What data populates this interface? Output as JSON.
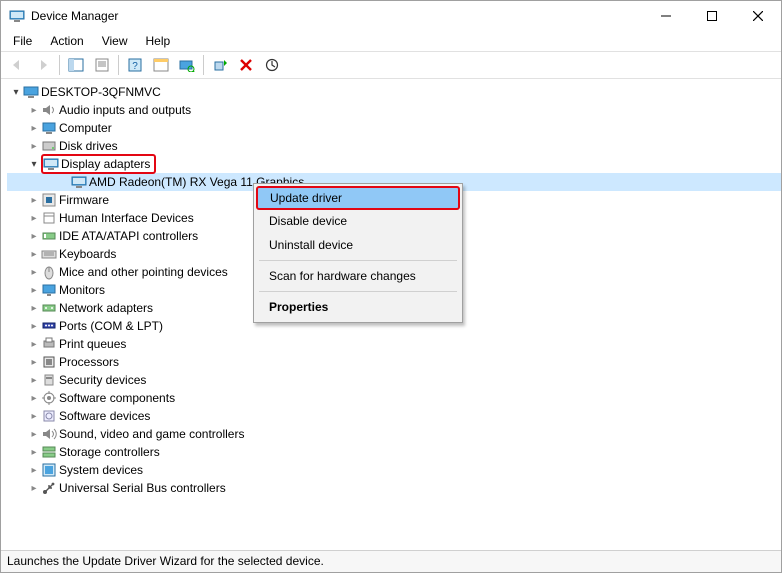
{
  "window": {
    "title": "Device Manager"
  },
  "menubar": [
    "File",
    "Action",
    "View",
    "Help"
  ],
  "tree": {
    "root": "DESKTOP-3QFNMVC",
    "selected_child": "AMD Radeon(TM) RX Vega 11 Graphics",
    "items": [
      {
        "label": "Audio inputs and outputs",
        "icon": "audio"
      },
      {
        "label": "Computer",
        "icon": "computer"
      },
      {
        "label": "Disk drives",
        "icon": "disk"
      },
      {
        "label": "Display adapters",
        "icon": "display",
        "expanded": true,
        "highlight": true,
        "children": [
          {
            "label": "AMD Radeon(TM) RX Vega 11 Graphics",
            "icon": "display",
            "selected": true
          }
        ]
      },
      {
        "label": "Firmware",
        "icon": "firmware"
      },
      {
        "label": "Human Interface Devices",
        "icon": "hid"
      },
      {
        "label": "IDE ATA/ATAPI controllers",
        "icon": "ide"
      },
      {
        "label": "Keyboards",
        "icon": "keyboard"
      },
      {
        "label": "Mice and other pointing devices",
        "icon": "mouse"
      },
      {
        "label": "Monitors",
        "icon": "monitor"
      },
      {
        "label": "Network adapters",
        "icon": "network"
      },
      {
        "label": "Ports (COM & LPT)",
        "icon": "port"
      },
      {
        "label": "Print queues",
        "icon": "printer"
      },
      {
        "label": "Processors",
        "icon": "cpu"
      },
      {
        "label": "Security devices",
        "icon": "security"
      },
      {
        "label": "Software components",
        "icon": "swcomp"
      },
      {
        "label": "Software devices",
        "icon": "swdev"
      },
      {
        "label": "Sound, video and game controllers",
        "icon": "sound"
      },
      {
        "label": "Storage controllers",
        "icon": "storage"
      },
      {
        "label": "System devices",
        "icon": "system"
      },
      {
        "label": "Universal Serial Bus controllers",
        "icon": "usb"
      }
    ]
  },
  "contextmenu": {
    "items": [
      {
        "label": "Update driver",
        "hover": true,
        "highlight": true
      },
      {
        "label": "Disable device"
      },
      {
        "label": "Uninstall device"
      },
      {
        "sep": true
      },
      {
        "label": "Scan for hardware changes"
      },
      {
        "sep": true
      },
      {
        "label": "Properties",
        "bold": true
      }
    ]
  },
  "statusbar": "Launches the Update Driver Wizard for the selected device."
}
